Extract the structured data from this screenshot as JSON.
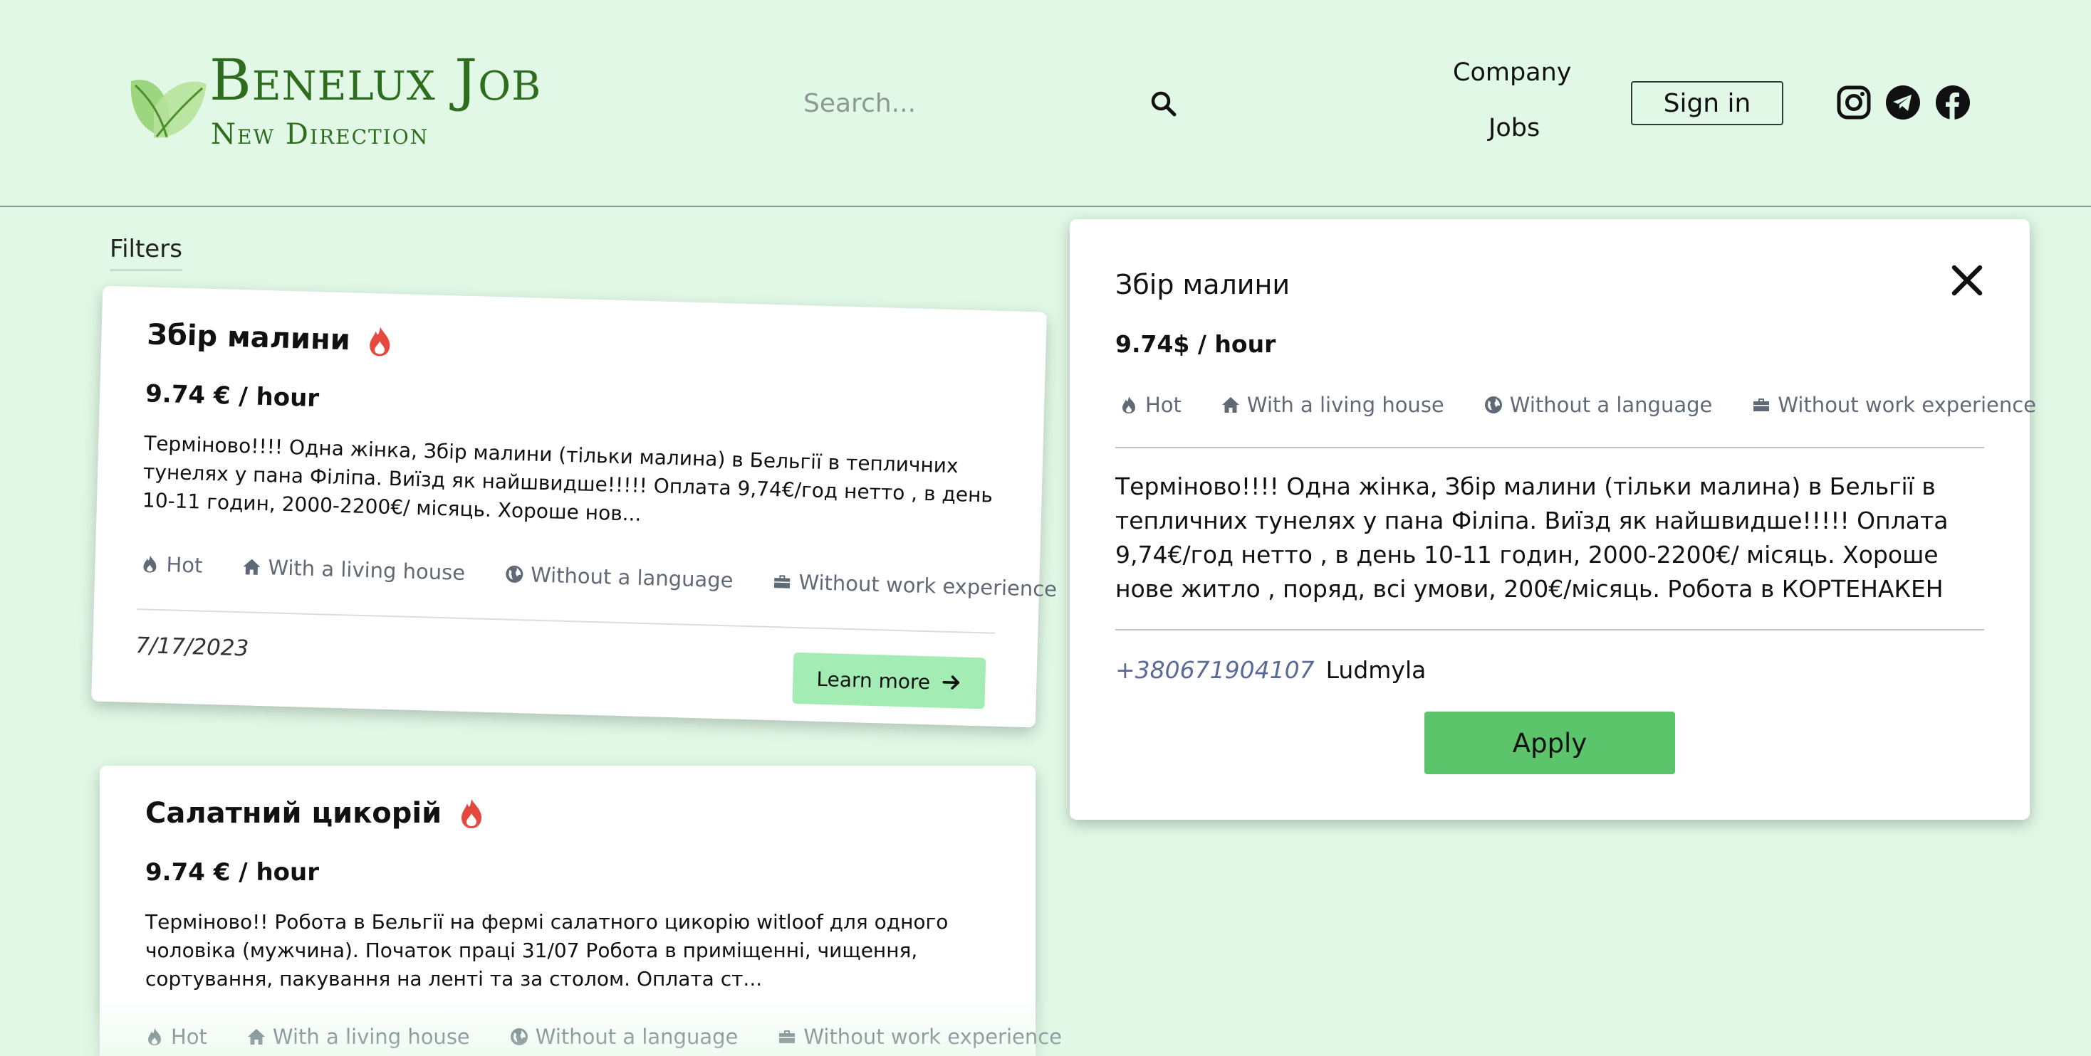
{
  "header": {
    "logo_title": "Benelux Job",
    "logo_subtitle": "New Direction",
    "search_placeholder": "Search...",
    "nav_company": "Company",
    "nav_jobs": "Jobs",
    "sign_in": "Sign in",
    "social_icons": [
      "instagram-icon",
      "telegram-icon",
      "facebook-icon"
    ]
  },
  "filters_label": "Filters",
  "jobs": [
    {
      "title": "Збір малини",
      "price": "9.74 € / hour",
      "description": "Терміново!!!! Одна жінка, Збір малини (тільки малина) в Бельгії в тепличних тунелях у пана Філіпа. Виїзд як найшвидше!!!!! Оплата 9,74€/год нетто , в день 10-11 годин, 2000-2200€/ місяць. Хороше нов...",
      "tags": [
        "Hot",
        "With a living house",
        "Without a language",
        "Without work experience"
      ],
      "date": "7/17/2023",
      "learn_more": "Learn more"
    },
    {
      "title": "Салатний цикорій",
      "price": "9.74 € / hour",
      "description": "Терміново!! Робота в Бельгії на фермі салатного цикорію witloof для одного чоловіка (мужчина). Початок праці 31/07 Робота в приміщенні, чищення, сортування, пакування на ленті та за столом. Оплата ст...",
      "tags": [
        "Hot",
        "With a living house",
        "Without a language",
        "Without work experience"
      ]
    }
  ],
  "detail": {
    "title": "Збір малини",
    "price": "9.74$ / hour",
    "tags": [
      "Hot",
      "With a living house",
      "Without a language",
      "Without work experience"
    ],
    "description": "Терміново!!!! Одна жінка, Збір малини (тільки малина) в Бельгії в тепличних тунелях у пана Філіпа. Виїзд як найшвидше!!!!! Оплата 9,74€/год нетто , в день 10-11 годин, 2000-2200€/ місяць. Хороше нове житло , поряд, всі умови, 200€/місяць. Робота в КОРТЕНАКЕН",
    "phone": "+380671904107",
    "contact_name": "Ludmyla",
    "apply": "Apply"
  },
  "colors": {
    "background": "#e1f8e6",
    "brand_green": "#2f6d1e",
    "apply_green": "#5cc46b",
    "learn_more_green": "#a3edb5",
    "hot_red": "#e5483f"
  }
}
